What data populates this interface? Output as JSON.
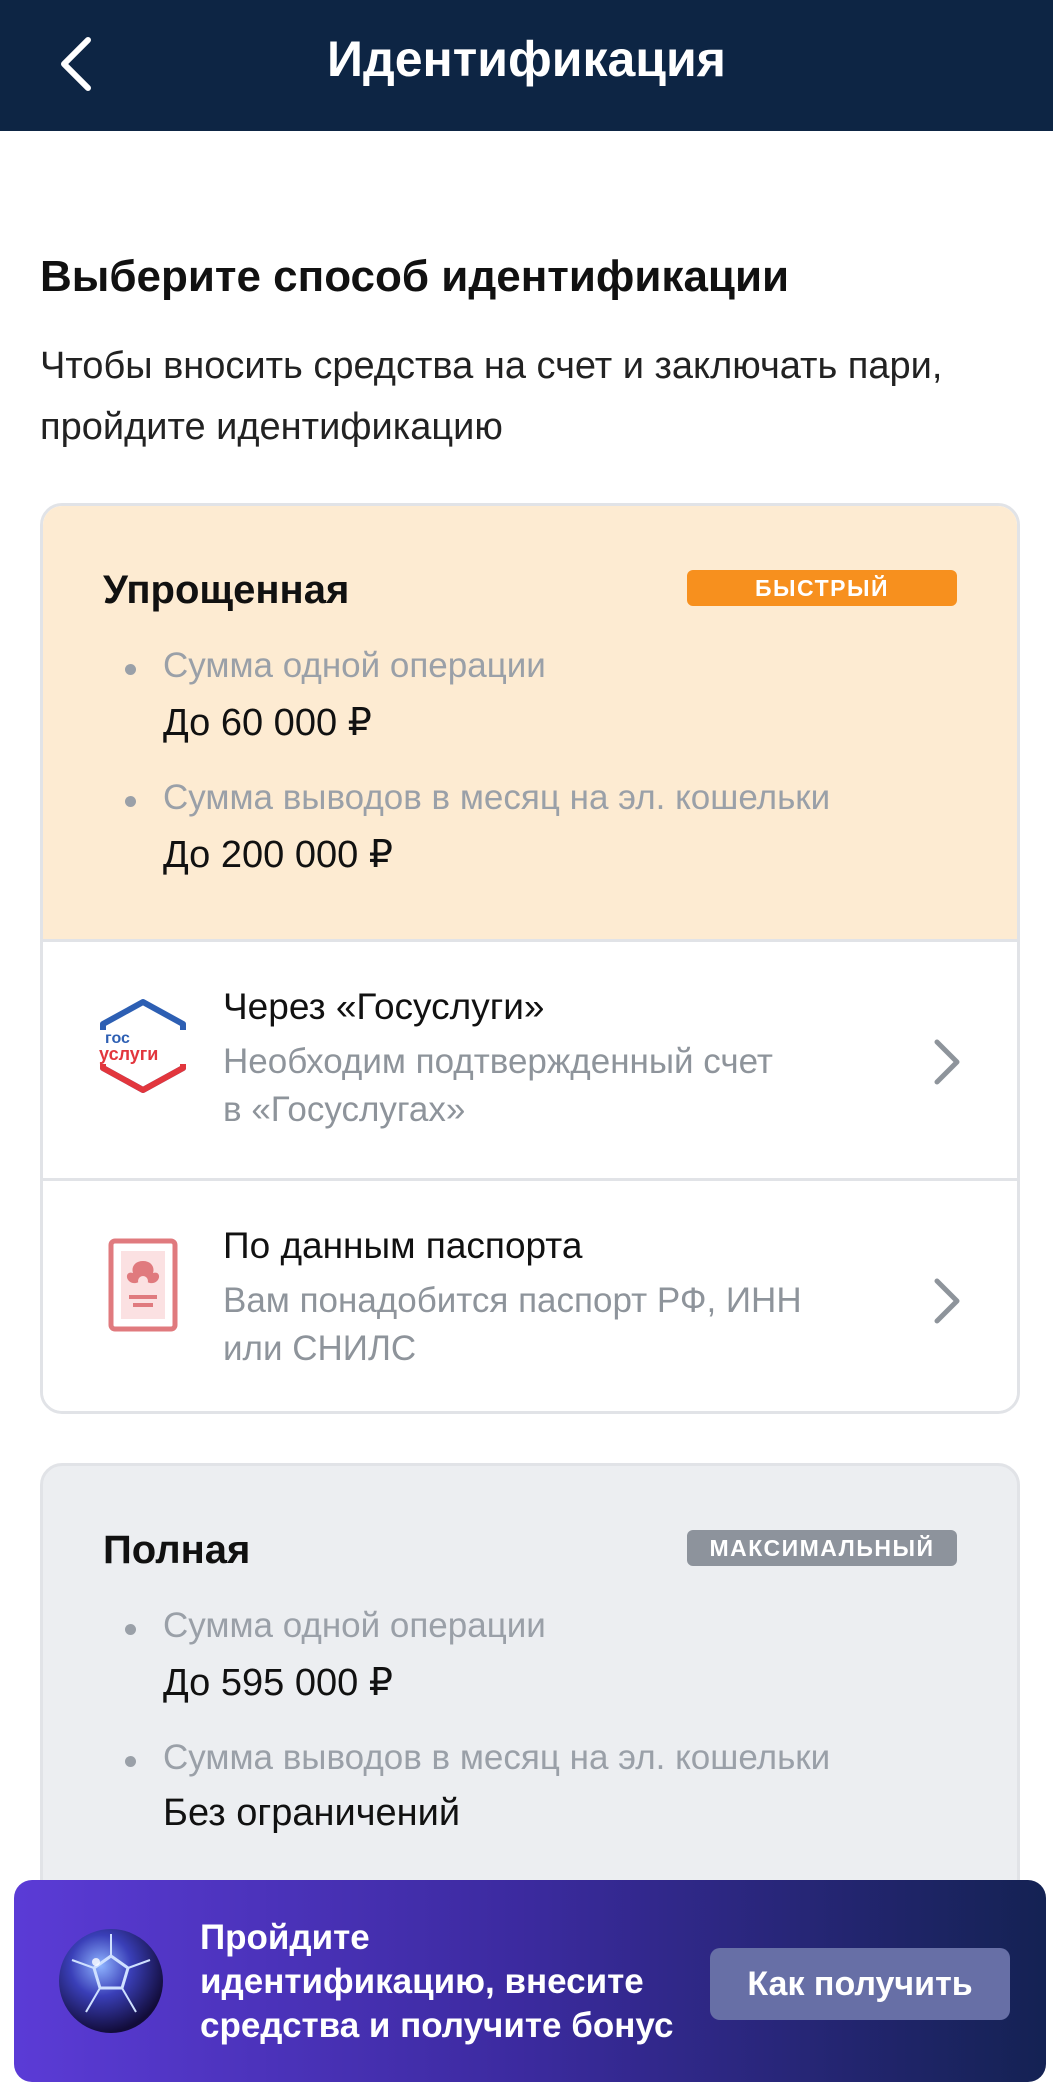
{
  "header": {
    "title": "Идентификация",
    "back_icon": "chevron-left-icon"
  },
  "intro": {
    "heading": "Выберите способ идентификации",
    "subtitle": "Чтобы вносить средства на счет и заключать пари, пройдите идентификацию"
  },
  "simple": {
    "title": "Упрощенная",
    "badge": "БЫСТРЫЙ",
    "badge_color": "#f7901e",
    "background": "#fdebd2",
    "limits": [
      {
        "label": "Сумма одной операции",
        "value": "До 60 000 ₽"
      },
      {
        "label": "Сумма выводов в месяц на эл. кошельки",
        "value": "До 200 000 ₽"
      }
    ],
    "methods": [
      {
        "title": "Через «Госуслуги»",
        "desc_line1": "Необходим подтвержденный счет",
        "desc_line2": "в «Госуслугах»",
        "icon": "gosuslugi-logo-icon",
        "logo_top": "гос",
        "logo_bottom": "услуги"
      },
      {
        "title": "По данным паспорта",
        "desc_line1": "Вам понадобится паспорт РФ, ИНН",
        "desc_line2": "или СНИЛС",
        "icon": "passport-icon"
      }
    ]
  },
  "full": {
    "title": "Полная",
    "badge": "МАКСИМАЛЬНЫЙ",
    "badge_color": "#8d939c",
    "limits": [
      {
        "label": "Сумма одной операции",
        "value": "До 595 000 ₽"
      },
      {
        "label": "Сумма выводов в месяц на эл. кошельки",
        "value": "Без ограничений"
      }
    ]
  },
  "promo": {
    "line1": "Пройдите",
    "line2": "идентификацию, внесите",
    "line3": "средства и получите бонус",
    "button": "Как получить",
    "icon": "soccer-ball-icon"
  }
}
